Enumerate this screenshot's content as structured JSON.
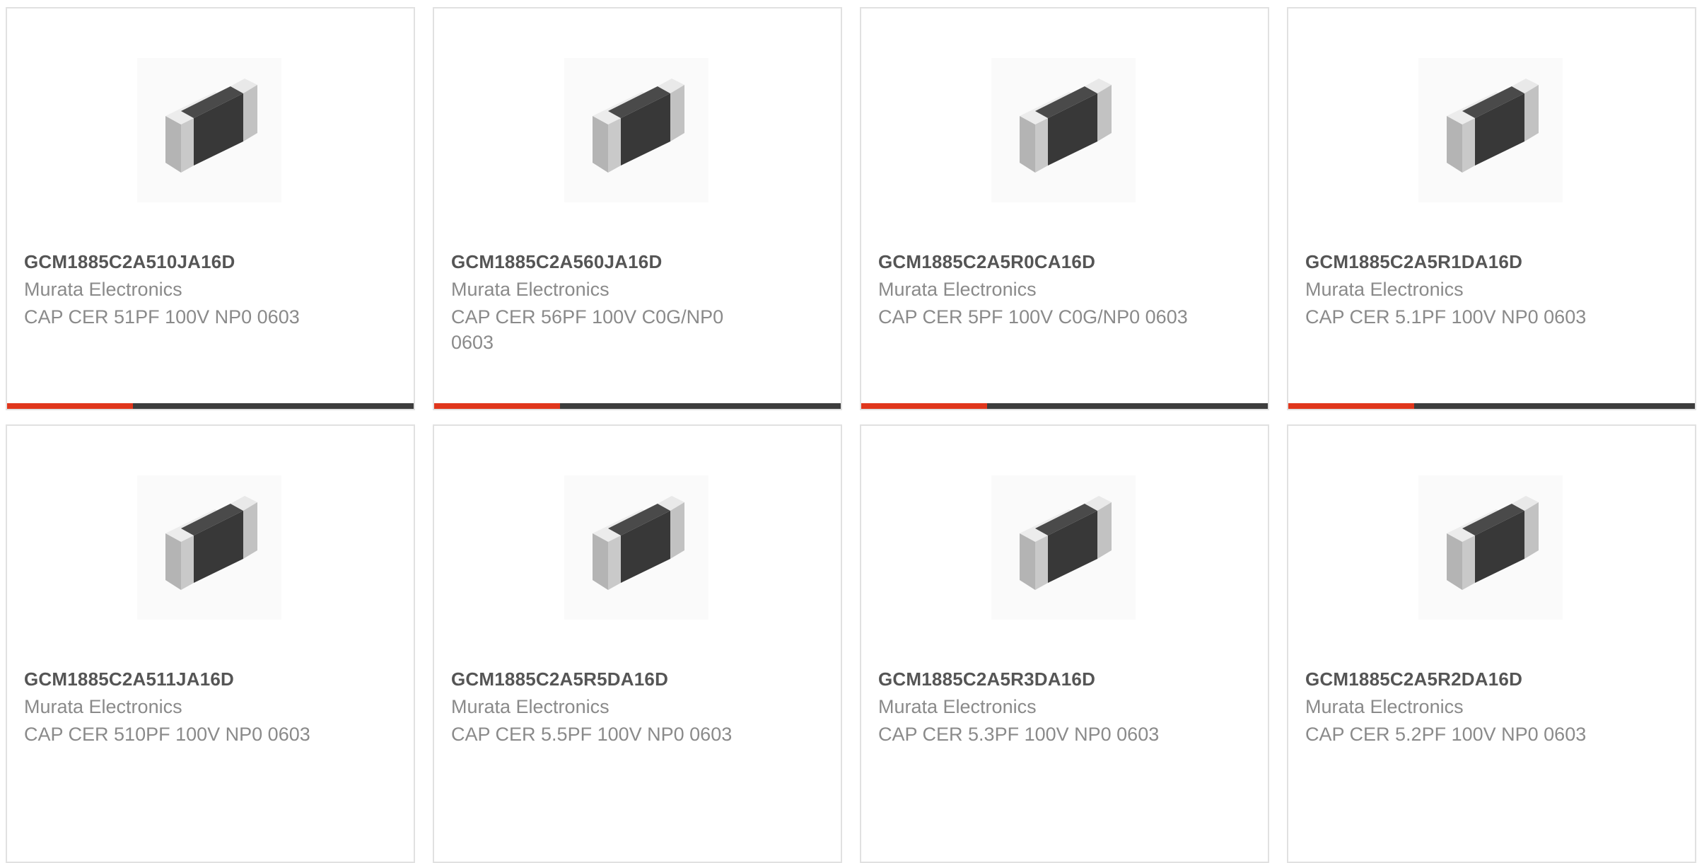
{
  "products": [
    {
      "part_number": "GCM1885C2A510JA16D",
      "manufacturer": "Murata Electronics",
      "description": "CAP CER 51PF 100V NP0 0603",
      "image_icon": "ceramic-capacitor-chip-icon",
      "bar_fill_percent": 31
    },
    {
      "part_number": "GCM1885C2A560JA16D",
      "manufacturer": "Murata Electronics",
      "description": "CAP CER 56PF 100V C0G/NP0 0603",
      "image_icon": "ceramic-capacitor-chip-icon",
      "bar_fill_percent": 31
    },
    {
      "part_number": "GCM1885C2A5R0CA16D",
      "manufacturer": "Murata Electronics",
      "description": "CAP CER 5PF 100V C0G/NP0 0603",
      "image_icon": "ceramic-capacitor-chip-icon",
      "bar_fill_percent": 31
    },
    {
      "part_number": "GCM1885C2A5R1DA16D",
      "manufacturer": "Murata Electronics",
      "description": "CAP CER 5.1PF 100V NP0 0603",
      "image_icon": "ceramic-capacitor-chip-icon",
      "bar_fill_percent": 31
    },
    {
      "part_number": "GCM1885C2A511JA16D",
      "manufacturer": "Murata Electronics",
      "description": "CAP CER 510PF 100V NP0 0603",
      "image_icon": "ceramic-capacitor-chip-icon"
    },
    {
      "part_number": "GCM1885C2A5R5DA16D",
      "manufacturer": "Murata Electronics",
      "description": "CAP CER 5.5PF 100V NP0 0603",
      "image_icon": "ceramic-capacitor-chip-icon"
    },
    {
      "part_number": "GCM1885C2A5R3DA16D",
      "manufacturer": "Murata Electronics",
      "description": "CAP CER 5.3PF 100V NP0 0603",
      "image_icon": "ceramic-capacitor-chip-icon"
    },
    {
      "part_number": "GCM1885C2A5R2DA16D",
      "manufacturer": "Murata Electronics",
      "description": "CAP CER 5.2PF 100V NP0 0603",
      "image_icon": "ceramic-capacitor-chip-icon"
    }
  ],
  "colors": {
    "card_border": "#e1e1e1",
    "part_number_text": "#555555",
    "secondary_text": "#8a8a8a",
    "bar_track": "#3d3d3d",
    "bar_fill": "#e0361c"
  }
}
